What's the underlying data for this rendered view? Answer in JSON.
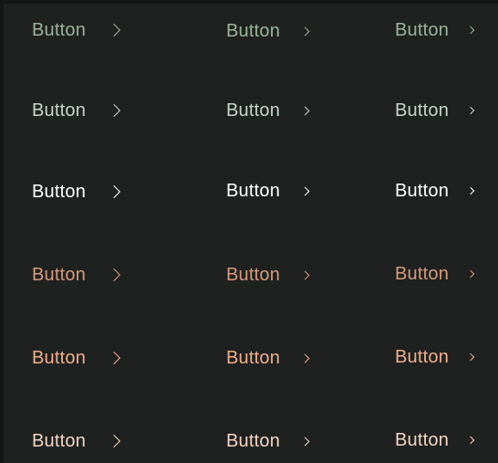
{
  "buttons": {
    "label": "Button",
    "chevron_icon": "chevron-right-icon"
  },
  "rows": [
    {
      "color": "#9bb59c"
    },
    {
      "color": "#c5d7cc"
    },
    {
      "color": "#ffffff"
    },
    {
      "color": "#d69b7b"
    },
    {
      "color": "#f0b08c"
    },
    {
      "color": "#f3d6c4"
    }
  ]
}
